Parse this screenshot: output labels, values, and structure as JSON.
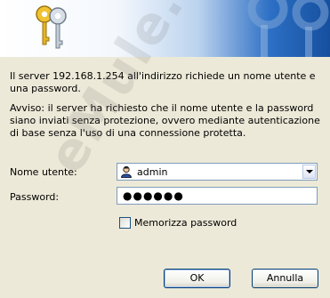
{
  "dialog": {
    "message": "Il server 192.168.1.254 all'indirizzo  richiede un nome utente e una password.",
    "warning": "Avviso: il server ha richiesto che il nome utente e la password siano inviati senza protezione, ovvero mediante autenticazione di base senza l'uso di una connessione protetta."
  },
  "username": {
    "label": "Nome utente:",
    "value": "admin"
  },
  "password": {
    "label": "Password:",
    "masked_value": "●●●●●●"
  },
  "remember": {
    "label": "Memorizza password",
    "checked": false
  },
  "buttons": {
    "ok": "OK",
    "cancel": "Annulla"
  },
  "watermark": "eMule.it",
  "icons": {
    "banner": "keys-icon",
    "user": "user-icon",
    "dropdown": "chevron-down-icon"
  }
}
